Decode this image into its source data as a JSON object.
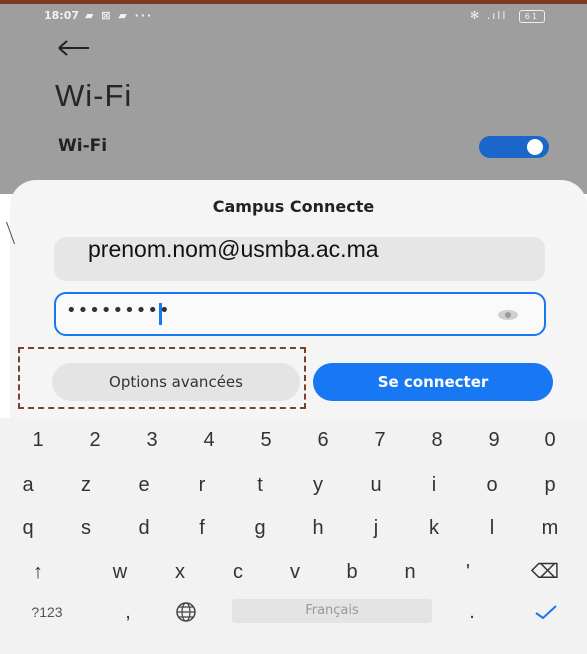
{
  "status_bar": {
    "time": "18:07",
    "left_icons": "▰ ⊠ ▰ ···",
    "right_icons": "✻ .ıll",
    "battery": "61"
  },
  "header": {
    "back_icon": "arrow-left-icon",
    "title": "Wi-Fi"
  },
  "wifi_row": {
    "label": "Wi-Fi",
    "toggle_on": true,
    "toggle_color": "#1a67c9"
  },
  "dialog": {
    "title": "Campus Connecte",
    "identity_value": "prenom.nom@usmba.ac.ma",
    "password_value": "•••••••••",
    "eye_icon": "eye-icon",
    "options_button": "Options avancées",
    "connect_button": "Se connecter",
    "accent": "#1877f2",
    "annotation_box_color": "#7a4325"
  },
  "keyboard": {
    "row_numbers": [
      "1",
      "2",
      "3",
      "4",
      "5",
      "6",
      "7",
      "8",
      "9",
      "0"
    ],
    "row_1": [
      "a",
      "z",
      "e",
      "r",
      "t",
      "y",
      "u",
      "i",
      "o",
      "p"
    ],
    "row_2": [
      "q",
      "s",
      "d",
      "f",
      "g",
      "h",
      "j",
      "k",
      "l",
      "m"
    ],
    "row_3": [
      "↑",
      "w",
      "x",
      "c",
      "v",
      "b",
      "n",
      "'",
      "⌫"
    ],
    "row_4": {
      "symbols": "?123",
      "comma": ",",
      "globe_icon": "globe-icon",
      "space": "Français",
      "period": ".",
      "enter_icon": "checkmark-icon"
    }
  }
}
